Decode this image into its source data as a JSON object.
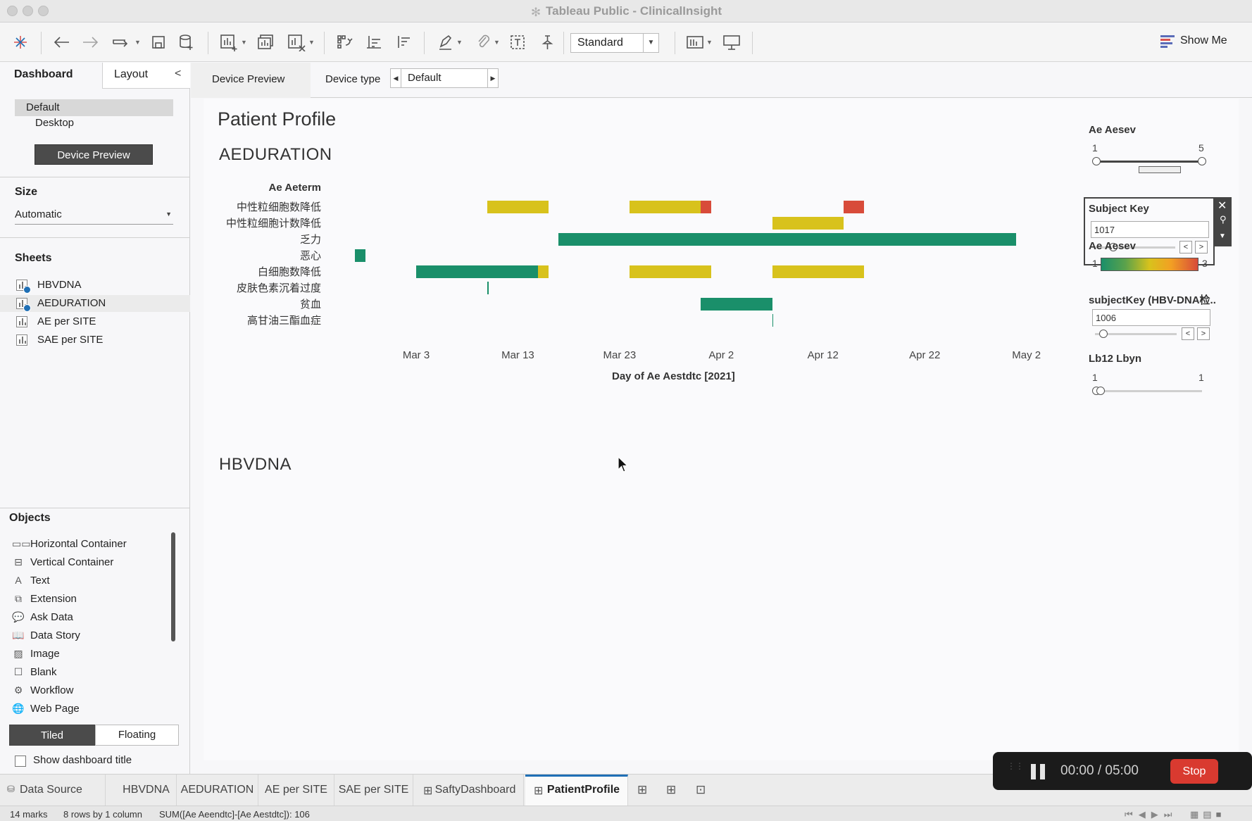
{
  "window": {
    "title": "Tableau Public - ClinicalInsight"
  },
  "toolbar": {
    "view_mode": "Standard",
    "show_me": "Show Me"
  },
  "left_panel": {
    "tabs": [
      "Dashboard",
      "Layout"
    ],
    "devices": {
      "default": "Default",
      "desktop": "Desktop"
    },
    "device_preview_button": "Device Preview",
    "size": {
      "title": "Size",
      "value": "Automatic"
    },
    "sheets": {
      "title": "Sheets",
      "items": [
        "HBVDNA",
        "AEDURATION",
        "AE per SITE",
        "SAE per SITE"
      ]
    },
    "objects": {
      "title": "Objects",
      "items": [
        "Horizontal Container",
        "Vertical Container",
        "Text",
        "Extension",
        "Ask Data",
        "Data Story",
        "Image",
        "Blank",
        "Workflow",
        "Web Page"
      ]
    },
    "tiled": "Tiled",
    "floating": "Floating",
    "show_title": "Show dashboard title"
  },
  "device_bar": {
    "tab": "Device Preview",
    "type_label": "Device type",
    "type_value": "Default"
  },
  "dashboard": {
    "title": "Patient Profile",
    "sheet1_title": "AEDURATION",
    "sheet2_title": "HBVDNA"
  },
  "chart_data": {
    "type": "bar",
    "subtype": "gantt",
    "ylabel": "Ae Aeterm",
    "xlabel": "Day of Ae Aestdtc [2021]",
    "x_ticks": [
      "Mar 3",
      "Mar 13",
      "Mar 23",
      "Apr 2",
      "Apr 12",
      "Apr 22",
      "May 2"
    ],
    "x_range": [
      "2021-02-22",
      "2021-05-05"
    ],
    "categories": [
      "中性粒细胞数降低",
      "中性粒细胞计数降低",
      "乏力",
      "恶心",
      "白细胞数降低",
      "皮肤色素沉着过度",
      "贫血",
      "高甘油三酯血症"
    ],
    "color_scale": {
      "low": "#1a8f6a",
      "mid": "#d8c21c",
      "high": "#d84b3a"
    },
    "bars": [
      {
        "category": "中性粒细胞数降低",
        "start": "2021-03-10",
        "end": "2021-03-16",
        "color": "#d8c21c"
      },
      {
        "category": "中性粒细胞数降低",
        "start": "2021-03-24",
        "end": "2021-03-31",
        "color": "#d8c21c"
      },
      {
        "category": "中性粒细胞数降低",
        "start": "2021-03-31",
        "end": "2021-04-01",
        "color": "#d84b3a"
      },
      {
        "category": "中性粒细胞数降低",
        "start": "2021-04-14",
        "end": "2021-04-16",
        "color": "#d84b3a"
      },
      {
        "category": "中性粒细胞计数降低",
        "start": "2021-04-07",
        "end": "2021-04-14",
        "color": "#d8c21c"
      },
      {
        "category": "乏力",
        "start": "2021-03-17",
        "end": "2021-05-01",
        "color": "#1a8f6a"
      },
      {
        "category": "恶心",
        "start": "2021-02-25",
        "end": "2021-02-26",
        "color": "#1a8f6a"
      },
      {
        "category": "白细胞数降低",
        "start": "2021-03-03",
        "end": "2021-03-15",
        "color": "#1a8f6a"
      },
      {
        "category": "白细胞数降低",
        "start": "2021-03-15",
        "end": "2021-03-16",
        "color": "#d8c21c"
      },
      {
        "category": "白细胞数降低",
        "start": "2021-03-24",
        "end": "2021-04-01",
        "color": "#d8c21c"
      },
      {
        "category": "白细胞数降低",
        "start": "2021-04-07",
        "end": "2021-04-16",
        "color": "#d8c21c"
      },
      {
        "category": "皮肤色素沉着过度",
        "start": "2021-03-10",
        "end": "2021-03-10",
        "color": "#1a8f6a"
      },
      {
        "category": "贫血",
        "start": "2021-03-31",
        "end": "2021-04-07",
        "color": "#1a8f6a"
      },
      {
        "category": "高甘油三酯血症",
        "start": "2021-04-07",
        "end": "2021-04-07",
        "color": "#1a8f6a"
      }
    ]
  },
  "filters": {
    "ae_aesev": {
      "title": "Ae Aesev",
      "min": "1",
      "max": "5"
    },
    "subject_key": {
      "title": "Subject Key",
      "value": "1017"
    },
    "ae_aesev_legend": {
      "title": "Ae Aesev",
      "min": "1",
      "max": "3"
    },
    "subject_key_hbv": {
      "title": "subjectKey (HBV-DNA检..",
      "value": "1006"
    },
    "lb12": {
      "title": "Lb12 Lbyn",
      "min": "1",
      "max": "1"
    }
  },
  "bottom_tabs": [
    "Data Source",
    "HBVDNA",
    "AEDURATION",
    "AE per SITE",
    "SAE per SITE",
    "SaftyDashboard",
    "PatientProfile"
  ],
  "status": {
    "marks": "14 marks",
    "dims": "8 rows by 1 column",
    "sum": "SUM([Ae Aeendtc]-[Ae Aestdtc]): 106"
  },
  "recording": {
    "time": "00:00  /  05:00",
    "stop": "Stop"
  }
}
